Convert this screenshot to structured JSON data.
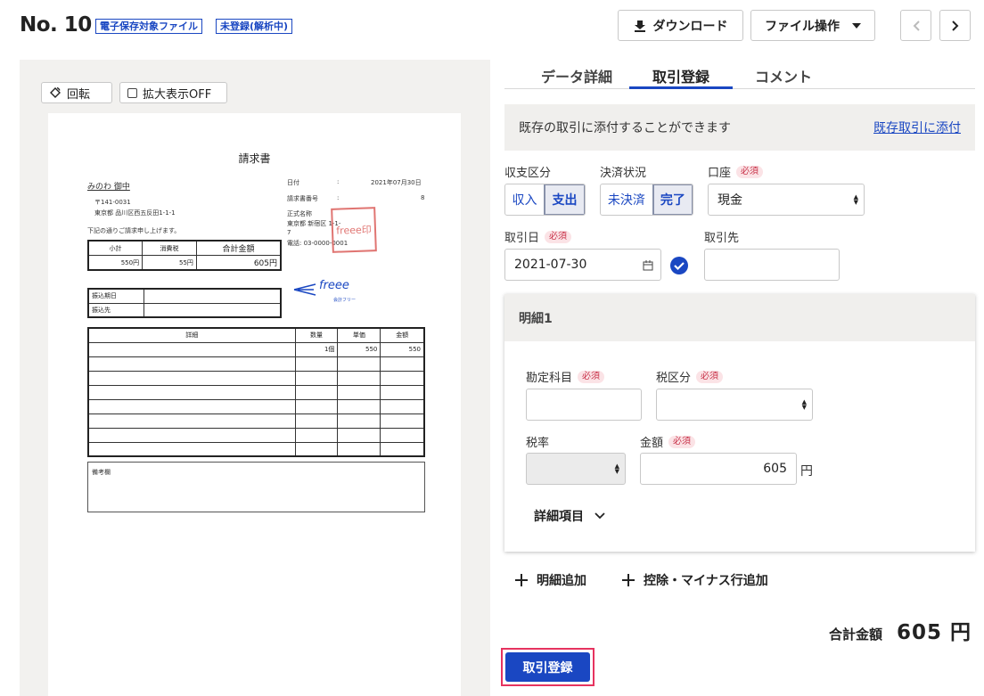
{
  "header": {
    "title": "No. 10",
    "badge_storage": "電子保存対象ファイル",
    "badge_status": "未登録(解析中)",
    "download_label": "ダウンロード",
    "file_ops_label": "ファイル操作",
    "accent_color": "#1a47c2"
  },
  "preview": {
    "rotate_label": "回転",
    "zoom_label": "拡大表示OFF",
    "invoice": {
      "title": "請求書",
      "recipient": "みのわ 御中",
      "postal": "〒141-0031",
      "address": "東京都 品川区西五反田1-1-1",
      "greeting": "下記の通りご請求申し上げます。",
      "date_label": "日付",
      "date_value": "2021年07月30日",
      "number_label": "請求書番号",
      "number_value": "8",
      "company_line1": "正式名称",
      "company_line2": "東京都 新宿区 1-1-",
      "company_line3": "7",
      "phone": "電話: 03-0000-0001",
      "stamp_text": "freee印",
      "logo_text": "freee",
      "logo_sub": "会計フリー",
      "summary_headers": [
        "小計",
        "消費税",
        "合計金額"
      ],
      "summary_values": [
        "550円",
        "55円",
        "605円"
      ],
      "payment_rows": [
        "振込期日",
        "振込先"
      ],
      "detail_headers": [
        "詳細",
        "数量",
        "単価",
        "金額"
      ],
      "detail_first_row": [
        "",
        "1個",
        "550",
        "550"
      ],
      "notes_label": "備考欄"
    }
  },
  "tabs": [
    "データ詳細",
    "取引登録",
    "コメント"
  ],
  "info": {
    "text": "既存の取引に添付することができます",
    "link": "既存取引に添付"
  },
  "form": {
    "required": "必須",
    "income_expense_label": "収支区分",
    "income": "収入",
    "expense": "支出",
    "settlement_label": "決済状況",
    "unsettled": "未決済",
    "settled": "完了",
    "account_label": "口座",
    "account_value": "現金",
    "date_label": "取引日",
    "date_value": "2021-07-30",
    "partner_label": "取引先",
    "partner_value": ""
  },
  "detail": {
    "title": "明細1",
    "account_item_label": "勘定科目",
    "tax_category_label": "税区分",
    "tax_rate_label": "税率",
    "amount_label": "金額",
    "amount_value": "605",
    "currency": "円",
    "more_label": "詳細項目"
  },
  "actions": {
    "add_detail": "明細追加",
    "add_deduction": "控除・マイナス行追加",
    "total_label": "合計金額",
    "total_value": "605 円",
    "submit": "取引登録"
  }
}
